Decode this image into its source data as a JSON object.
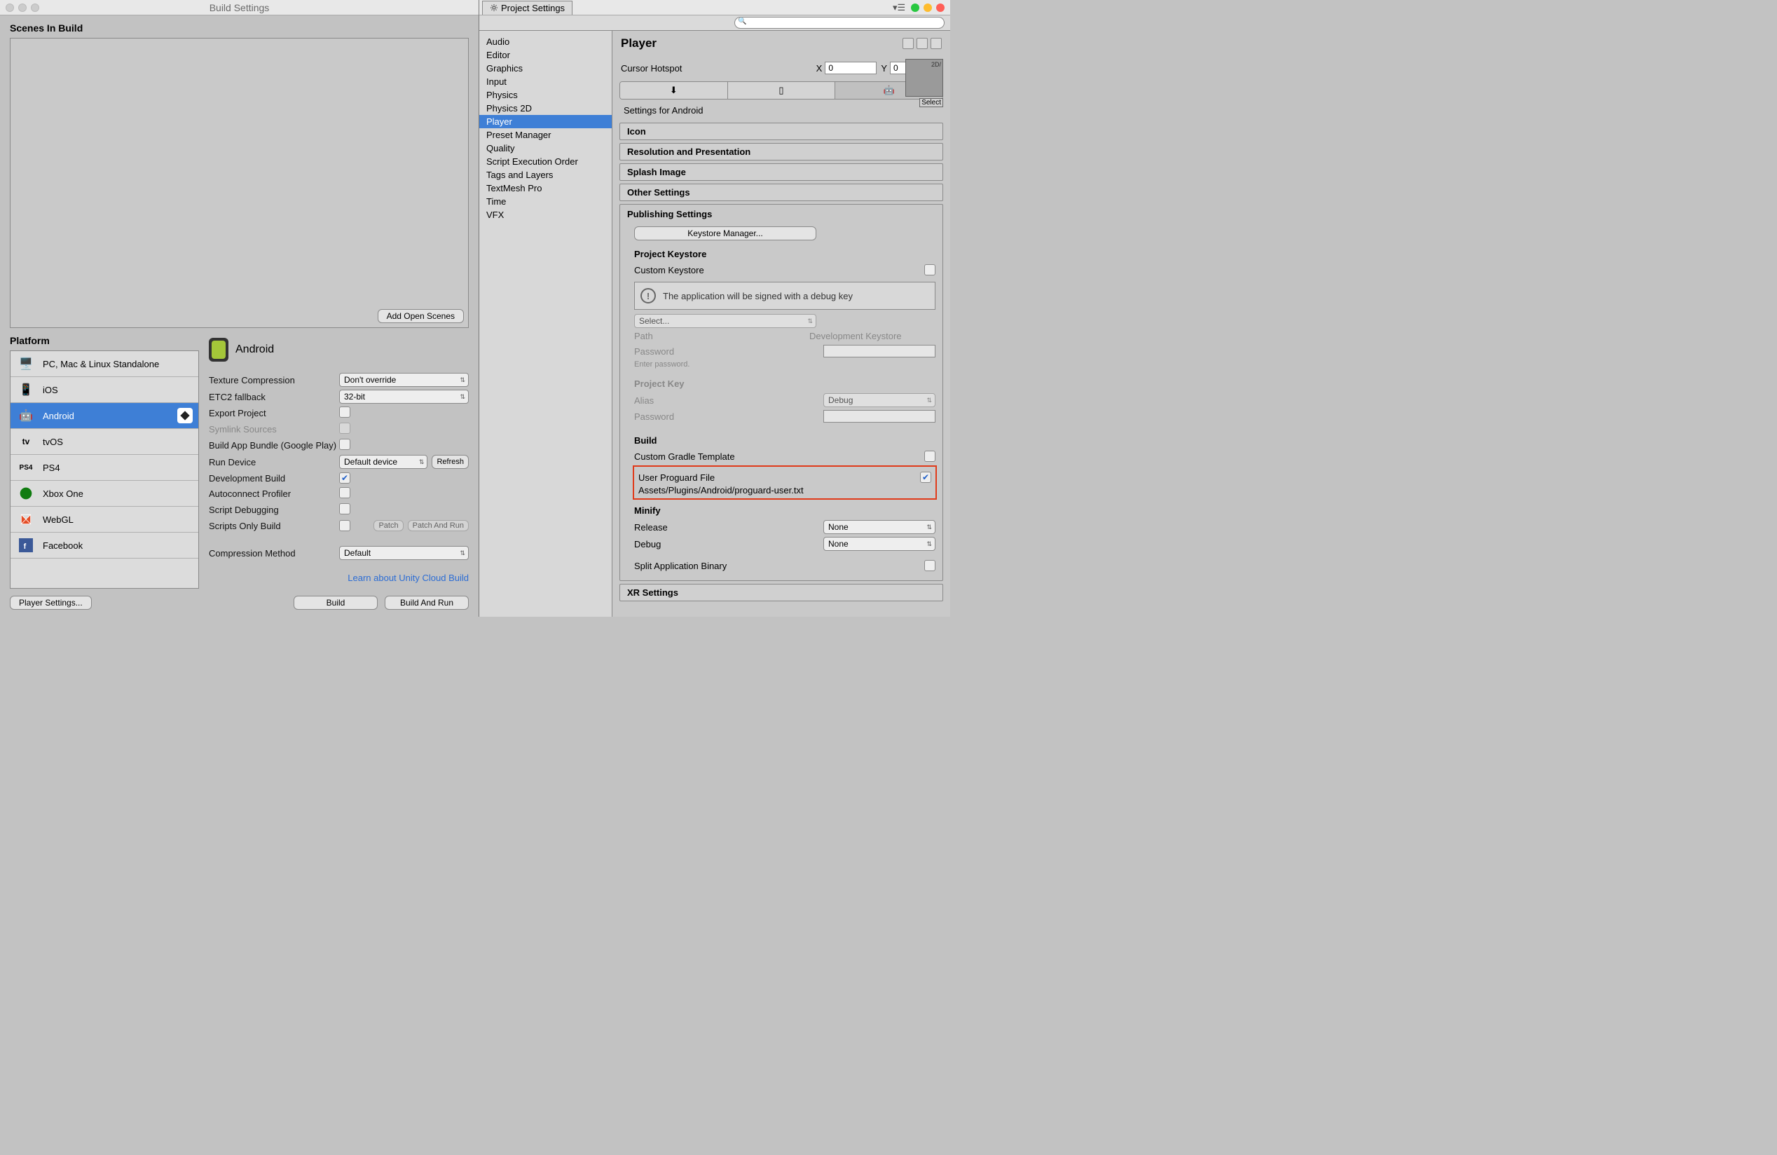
{
  "left": {
    "title": "Build Settings",
    "scenes_label": "Scenes In Build",
    "add_open_scenes": "Add Open Scenes",
    "platform_label": "Platform",
    "platforms": [
      "PC, Mac & Linux Standalone",
      "iOS",
      "Android",
      "tvOS",
      "PS4",
      "Xbox One",
      "WebGL",
      "Facebook"
    ],
    "selected_platform_name": "Android",
    "opts": {
      "texture_compression": {
        "label": "Texture Compression",
        "value": "Don't override"
      },
      "etc2_fallback": {
        "label": "ETC2 fallback",
        "value": "32-bit"
      },
      "export_project": {
        "label": "Export Project"
      },
      "symlink_sources": {
        "label": "Symlink Sources"
      },
      "build_app_bundle": {
        "label": "Build App Bundle (Google Play)"
      },
      "run_device": {
        "label": "Run Device",
        "value": "Default device",
        "refresh": "Refresh"
      },
      "dev_build": {
        "label": "Development Build",
        "checked": "✔"
      },
      "autoconnect": {
        "label": "Autoconnect Profiler"
      },
      "script_debug": {
        "label": "Script Debugging"
      },
      "scripts_only": {
        "label": "Scripts Only Build",
        "patch": "Patch",
        "patch_run": "Patch And Run"
      },
      "compression": {
        "label": "Compression Method",
        "value": "Default"
      }
    },
    "learn_link": "Learn about Unity Cloud Build",
    "player_settings_btn": "Player Settings...",
    "build_btn": "Build",
    "build_run_btn": "Build And Run"
  },
  "right": {
    "tab_title": "Project Settings",
    "categories": [
      "Audio",
      "Editor",
      "Graphics",
      "Input",
      "Physics",
      "Physics 2D",
      "Player",
      "Preset Manager",
      "Quality",
      "Script Execution Order",
      "Tags and Layers",
      "TextMesh Pro",
      "Time",
      "VFX"
    ],
    "selected_category": "Player",
    "main_title": "Player",
    "cursor_hotspot_label": "Cursor Hotspot",
    "x_label": "X",
    "y_label": "Y",
    "x_val": "0",
    "y_val": "0",
    "settings_for": "Settings for Android",
    "sections": {
      "icon": "Icon",
      "resolution": "Resolution and Presentation",
      "splash": "Splash Image",
      "other": "Other Settings",
      "publishing": "Publishing Settings",
      "xr": "XR Settings"
    },
    "publishing": {
      "keystore_manager": "Keystore Manager...",
      "project_keystore": "Project Keystore",
      "custom_keystore": "Custom Keystore",
      "info": "The application will be signed with a debug key",
      "select": "Select...",
      "path_label": "Path",
      "path_value": "Development Keystore",
      "password_label": "Password",
      "enter_password_hint": "Enter password.",
      "project_key": "Project Key",
      "alias_label": "Alias",
      "alias_value": "Debug",
      "pw2_label": "Password",
      "build_hdr": "Build",
      "custom_gradle": "Custom Gradle Template",
      "user_proguard": "User Proguard File",
      "proguard_path": "Assets/Plugins/Android/proguard-user.txt",
      "minify": "Minify",
      "release_label": "Release",
      "release_value": "None",
      "debug_label": "Debug",
      "debug_value": "None",
      "split_binary": "Split Application Binary"
    },
    "select_label": "Select",
    "preview_label": "2D/"
  }
}
